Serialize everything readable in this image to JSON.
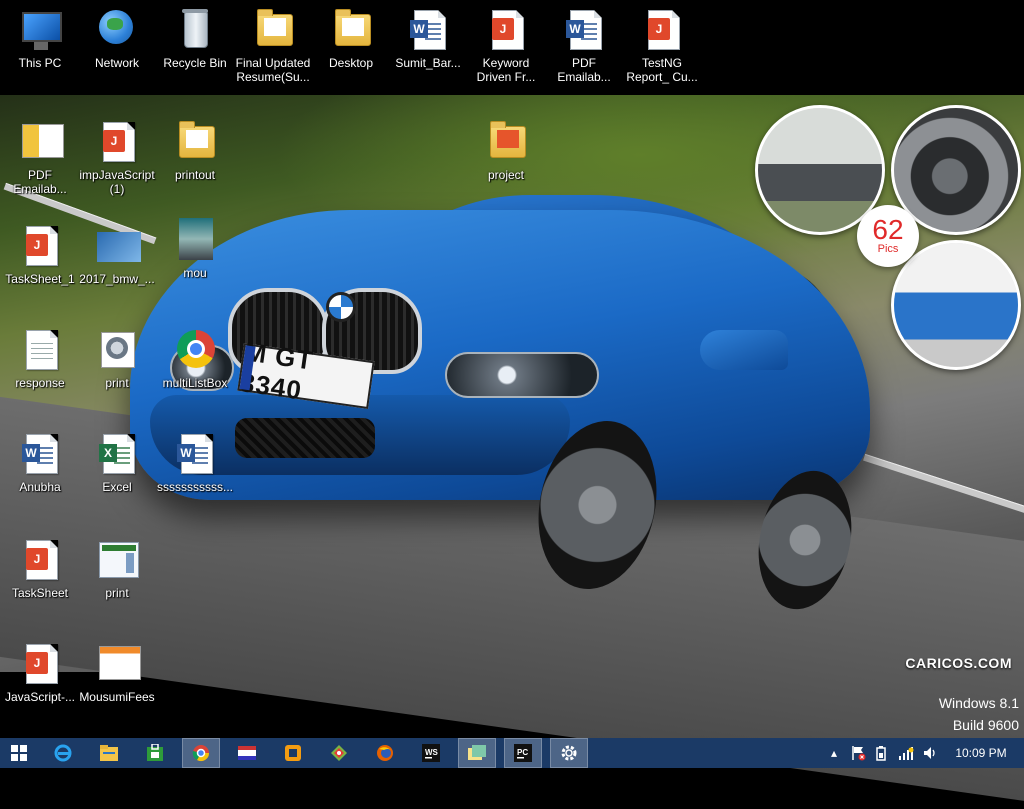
{
  "desktop": {
    "top_row": [
      {
        "label": "This PC",
        "icon": "computer-icon"
      },
      {
        "label": "Network",
        "icon": "network-icon"
      },
      {
        "label": "Recycle Bin",
        "icon": "recycle-bin-icon"
      },
      {
        "label": "Final Updated Resume(Su...",
        "icon": "folder-icon"
      },
      {
        "label": "Desktop",
        "icon": "folder-icon"
      },
      {
        "label": "Sumit_Bar...",
        "icon": "word-document-icon"
      },
      {
        "label": "Keyword Driven Fr...",
        "icon": "pdf-document-icon"
      },
      {
        "label": "PDF Emailab...",
        "icon": "word-document-icon"
      },
      {
        "label": "TestNG Report_ Cu...",
        "icon": "pdf-document-icon"
      }
    ],
    "icons": [
      {
        "label": "PDF Emailab...",
        "icon": "spreadsheet-thumbnail-icon"
      },
      {
        "label": "impJavaScript (1)",
        "icon": "pdf-document-icon"
      },
      {
        "label": "printout",
        "icon": "folder-icon"
      },
      {
        "label": "project",
        "icon": "folder-icon"
      },
      {
        "label": "TaskSheet_1",
        "icon": "pdf-document-icon"
      },
      {
        "label": "2017_bmw_...",
        "icon": "image-thumbnail-icon"
      },
      {
        "label": "mou",
        "icon": "photo-thumbnail-icon"
      },
      {
        "label": "response",
        "icon": "text-document-icon"
      },
      {
        "label": "print",
        "icon": "printer-app-icon"
      },
      {
        "label": "multiListBox",
        "icon": "chrome-icon"
      },
      {
        "label": "Anubha",
        "icon": "word-document-icon"
      },
      {
        "label": "Excel",
        "icon": "excel-document-icon"
      },
      {
        "label": "sssssssssss...",
        "icon": "word-document-icon"
      },
      {
        "label": "TaskSheet",
        "icon": "pdf-document-icon"
      },
      {
        "label": "print",
        "icon": "window-thumbnail-icon"
      },
      {
        "label": "JavaScript-...",
        "icon": "pdf-document-icon"
      },
      {
        "label": "MousumiFees",
        "icon": "spreadsheet-thumbnail-icon"
      }
    ]
  },
  "wallpaper": {
    "plate_text": "M GT 3340",
    "badge_count": "62",
    "badge_label": "Pics",
    "watermark_site": "CARICOS.COM"
  },
  "os_watermark": {
    "line1": "Windows 8.1",
    "line2": "Build 9600"
  },
  "taskbar": {
    "pinned": [
      {
        "name": "start-button",
        "icon": "windows-logo-icon"
      },
      {
        "name": "internet-explorer-button",
        "icon": "internet-explorer-icon"
      },
      {
        "name": "file-explorer-button",
        "icon": "file-explorer-icon"
      },
      {
        "name": "store-button",
        "icon": "store-icon"
      },
      {
        "name": "chrome-button",
        "icon": "chrome-icon"
      },
      {
        "name": "app-button-1",
        "icon": "flag-app-icon"
      },
      {
        "name": "app-button-2",
        "icon": "orange-app-icon"
      },
      {
        "name": "app-button-3",
        "icon": "colorful-app-icon"
      },
      {
        "name": "firefox-button",
        "icon": "firefox-icon"
      },
      {
        "name": "webstorm-button",
        "icon": "webstorm-icon"
      },
      {
        "name": "notes-button",
        "icon": "notes-icon"
      },
      {
        "name": "pycharm-button",
        "icon": "pycharm-icon"
      },
      {
        "name": "settings-button",
        "icon": "gear-icon"
      }
    ],
    "clock": "10:09 PM"
  },
  "colors": {
    "taskbar": "#1b3a66",
    "badge_text": "#e02a2a"
  }
}
